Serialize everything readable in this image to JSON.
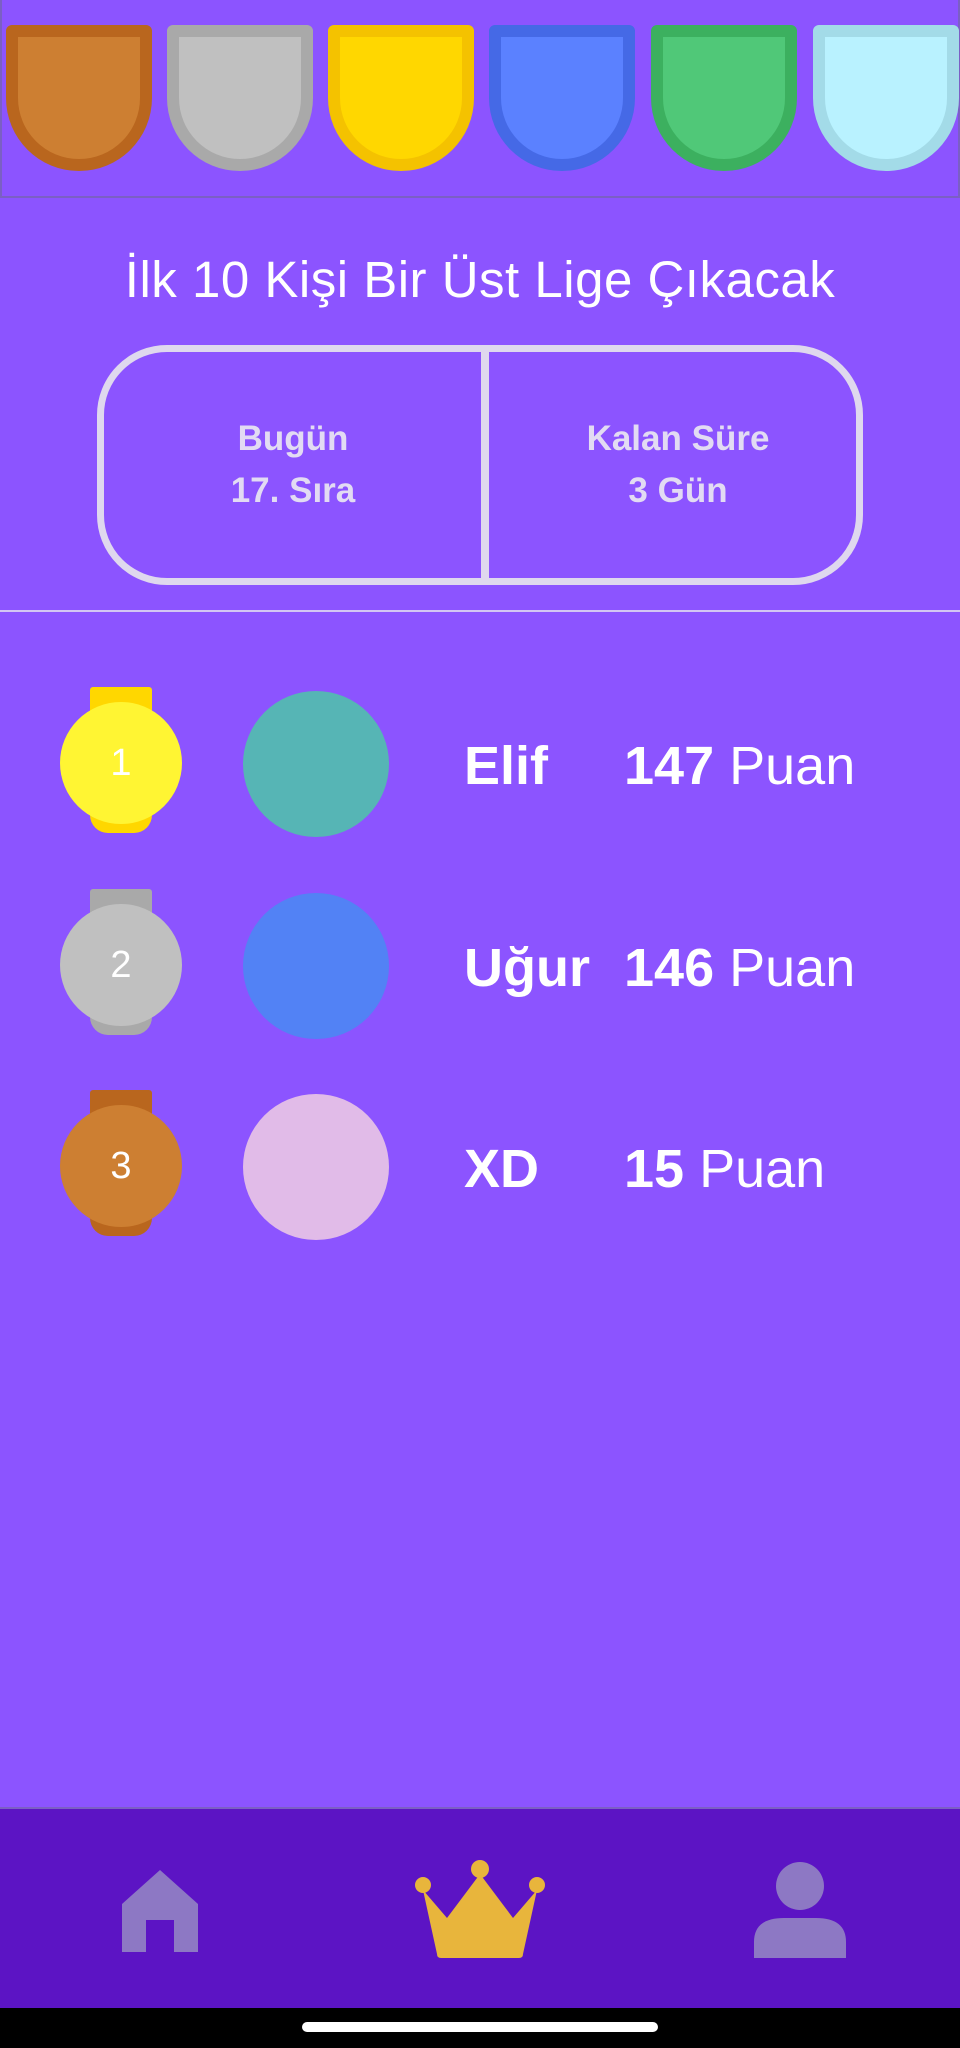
{
  "leagues": [
    {
      "icon": "bronze-league-shield",
      "fill": "#cd7f32",
      "border": "#b9661e"
    },
    {
      "icon": "silver-league-shield",
      "fill": "#c0c0c0",
      "border": "#a9a9a9"
    },
    {
      "icon": "gold-league-shield",
      "fill": "#ffd700",
      "border": "#f4c200"
    },
    {
      "icon": "sapphire-league-shield",
      "fill": "#5b81ff",
      "border": "#4569e6"
    },
    {
      "icon": "emerald-league-shield",
      "fill": "#50c878",
      "border": "#3cb05f"
    },
    {
      "icon": "diamond-league-shield",
      "fill": "#b9f2ff",
      "border": "#a3dbe8"
    }
  ],
  "headline": "İlk 10 Kişi Bir Üst Lige Çıkacak",
  "status": {
    "today_label": "Bugün",
    "today_value": "17. Sıra",
    "remaining_label": "Kalan Süre",
    "remaining_value": "3 Gün"
  },
  "leaderboard": [
    {
      "rank": "1",
      "name": "Elif",
      "points": "147",
      "unit": "Puan",
      "medal_color": "#fff533",
      "ribbon_color": "#ffd700",
      "avatar_color": "#56b5b5"
    },
    {
      "rank": "2",
      "name": "Uğur",
      "points": "146",
      "unit": "Puan",
      "medal_color": "#c0c0c0",
      "ribbon_color": "#a9a9a9",
      "avatar_color": "#5282f5"
    },
    {
      "rank": "3",
      "name": "XD",
      "points": "15",
      "unit": "Puan",
      "medal_color": "#cd7f32",
      "ribbon_color": "#b9661e",
      "avatar_color": "#e1bbe8"
    }
  ],
  "nav": {
    "items": [
      {
        "icon": "home-icon",
        "active": false
      },
      {
        "icon": "crown-icon",
        "active": true
      },
      {
        "icon": "profile-icon",
        "active": false
      }
    ],
    "inactive_color": "#8d78c4",
    "active_color": "#e8b53c"
  }
}
